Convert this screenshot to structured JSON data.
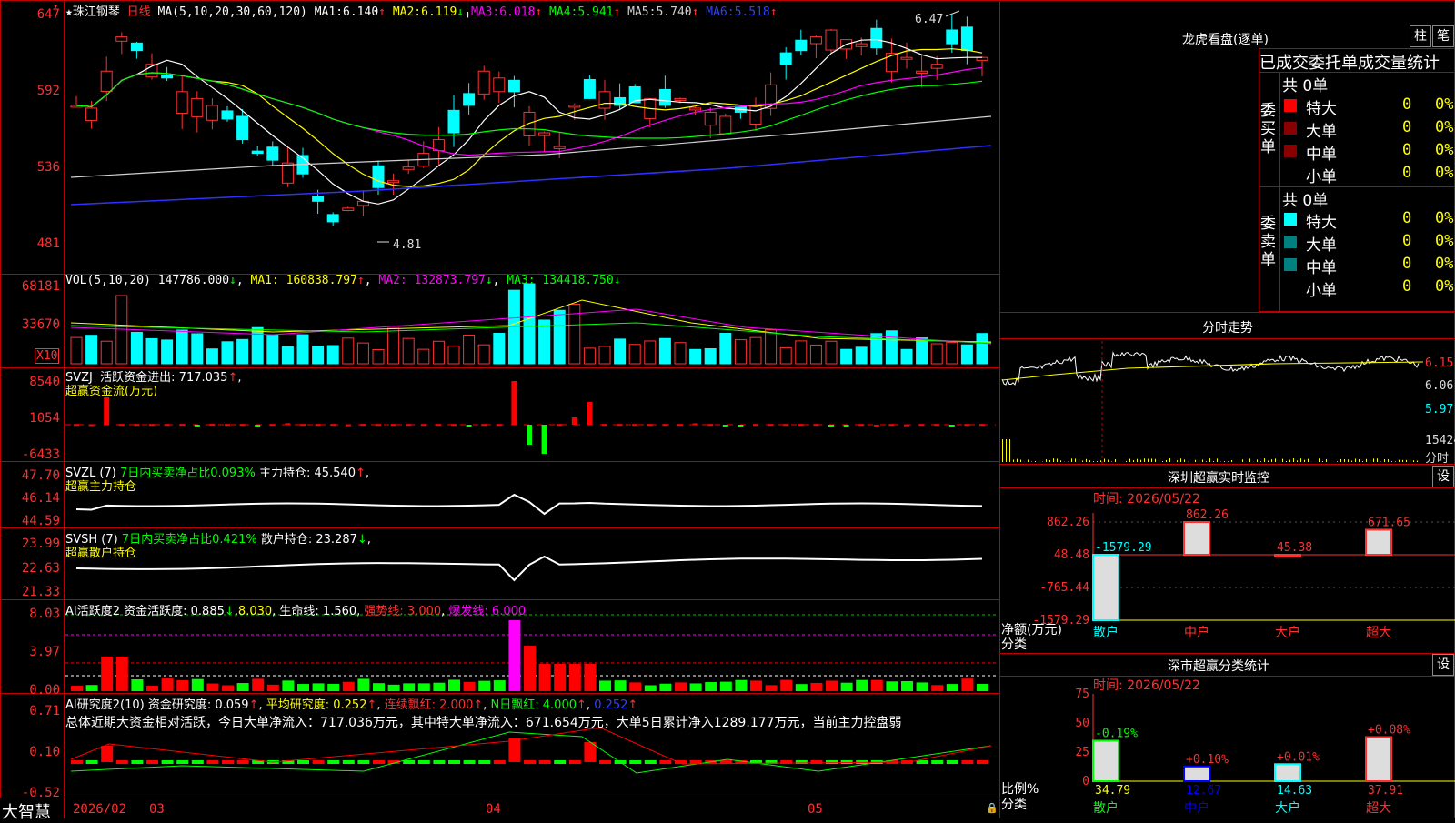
{
  "app": {
    "brand": "大智慧",
    "stock_name": "珠江钢琴",
    "period": "日线"
  },
  "colors": {
    "up": "#ff3232",
    "down": "#00ffff",
    "ma1": "#ffffff",
    "ma2": "#ffff00",
    "ma3": "#ff00ff",
    "ma4": "#00ff00",
    "ma5": "#d0d0d0",
    "ma6": "#0000ff"
  },
  "main_chart": {
    "ma_header": "MA(5,10,20,30,60,120)",
    "ma": [
      {
        "label": "MA1:",
        "value": "6.140",
        "arrow": "↑"
      },
      {
        "label": "MA2:",
        "value": "6.119",
        "arrow": "↓"
      },
      {
        "label": "MA3:",
        "value": "6.018",
        "arrow": "↑"
      },
      {
        "label": "MA4:",
        "value": "5.941",
        "arrow": "↑"
      },
      {
        "label": "MA5:",
        "value": "5.740",
        "arrow": "↑"
      },
      {
        "label": "MA6:",
        "value": "5.518",
        "arrow": "↑"
      }
    ],
    "y_ticks": [
      "647",
      "592",
      "536",
      "481"
    ],
    "high_marker": "6.47",
    "low_marker": "4.81"
  },
  "vol_panel": {
    "header": "VOL(5,10,20)",
    "vol": "147786.000",
    "vol_arrow": "↓",
    "ma1": "MA1: 160838.797",
    "ma1_arrow": "↑",
    "ma2": "MA2: 132873.797",
    "ma2_arrow": "↓",
    "ma3": "MA3: 134418.750",
    "ma3_arrow": "↓",
    "y_ticks": [
      "68181",
      "33670"
    ],
    "unit": "X10"
  },
  "svzj_panel": {
    "header": "SVZJ",
    "line1": "活跃资金进出: 717.035",
    "arrow": "↑",
    "line2": "超赢资金流(万元)",
    "y_ticks": [
      "8540",
      "1054",
      "-6433"
    ]
  },
  "svzl_panel": {
    "header": "SVZL (7)",
    "ratio": "7日内买卖净占比0.093%",
    "hold": "主力持仓: 45.540",
    "arrow": "↑",
    "line2": "超赢主力持仓",
    "y_ticks": [
      "47.70",
      "46.14",
      "44.59"
    ]
  },
  "svsh_panel": {
    "header": "SVSH (7)",
    "ratio": "7日内买卖净占比0.421%",
    "hold": "散户持仓: 23.287",
    "arrow": "↓",
    "line2": "超赢散户持仓",
    "y_ticks": [
      "23.99",
      "22.63",
      "21.33"
    ]
  },
  "ai_active": {
    "header": "AI活跃度2",
    "a": "资金活跃度: 0.885",
    "a_arrow": "↓",
    "b": "8.030",
    "c": "生命线: 1.560",
    "d": "强势线: 3.000",
    "e": "爆发线: 6.000",
    "y_ticks": [
      "8.03",
      "3.97",
      "0.00"
    ]
  },
  "ai_research": {
    "header": "AI研究度2(10)",
    "a": "资金研究度: 0.059",
    "b": "平均研究度: 0.252",
    "c": "连续飘红: 2.000",
    "d": "N日飘红: 4.000",
    "e": "0.252",
    "summary": "总体近期大资金相对活跃，今日大单净流入：717.036万元，其中特大单净流入：671.654万元，大单5日累计净入1289.177万元，当前主力控盘弱",
    "y_ticks": [
      "0.71",
      "0.10",
      "-0.52"
    ]
  },
  "x_axis": {
    "labels": [
      "2026/02",
      "03",
      "04",
      "05"
    ]
  },
  "right": {
    "dragon": {
      "title": "龙虎看盘(逐单)",
      "btn1": "柱",
      "btn2": "笔",
      "columns": "已成交委托单成交量统计",
      "buy": {
        "side": "委买单",
        "total": "共 0单",
        "rows": [
          {
            "name": "特大",
            "v": "0",
            "p": "0%"
          },
          {
            "name": "大单",
            "v": "0",
            "p": "0%"
          },
          {
            "name": "中单",
            "v": "0",
            "p": "0%"
          },
          {
            "name": "小单",
            "v": "0",
            "p": "0%"
          }
        ]
      },
      "sell": {
        "side": "委卖单",
        "total": "共 0单",
        "rows": [
          {
            "name": "特大",
            "v": "0",
            "p": "0%"
          },
          {
            "name": "大单",
            "v": "0",
            "p": "0%"
          },
          {
            "name": "中单",
            "v": "0",
            "p": "0%"
          },
          {
            "name": "小单",
            "v": "0",
            "p": "0%"
          }
        ]
      }
    },
    "minute": {
      "title": "分时走势",
      "prices": [
        "6.15",
        "6.06",
        "5.97"
      ],
      "vol": "15424",
      "vol_label": "分时"
    },
    "sz_monitor": {
      "title": "深圳超赢实时监控",
      "btn": "设",
      "time": "时间: 2026/05/22",
      "y_ticks": [
        "862.26",
        "48.48",
        "-765.44",
        "-1579.29"
      ],
      "y_label1": "净额(万元)",
      "y_label2": "分类",
      "categories": [
        "散户",
        "中户",
        "大户",
        "超大"
      ],
      "values": [
        "-1579.29",
        "862.26",
        "45.38",
        "671.65"
      ]
    },
    "sz_class": {
      "title": "深市超赢分类统计",
      "btn": "设",
      "time": "时间: 2026/05/22",
      "y_ticks": [
        "75",
        "50",
        "25",
        "0"
      ],
      "y_label1": "比例%",
      "y_label2": "分类",
      "categories": [
        "散户",
        "中户",
        "大户",
        "超大"
      ],
      "changes": [
        "-0.19%",
        "+0.10%",
        "+0.01%",
        "+0.08%"
      ],
      "values": [
        "34.79",
        "12.67",
        "14.63",
        "37.91"
      ]
    }
  }
}
